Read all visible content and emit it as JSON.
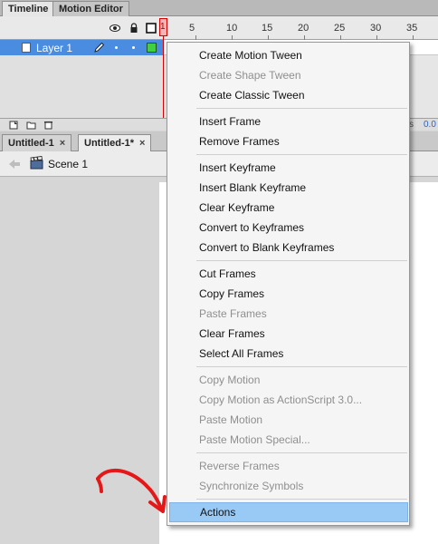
{
  "panel_tabs": {
    "timeline": "Timeline",
    "motion_editor": "Motion Editor"
  },
  "timeline": {
    "ruler_numbers": [
      "5",
      "10",
      "15",
      "20",
      "25",
      "30",
      "35"
    ],
    "playhead_frame": "1",
    "layer": {
      "name": "Layer 1",
      "color": "#3fd13f"
    },
    "footer_status": "s",
    "footer_value": "0.0"
  },
  "doc_tabs": [
    {
      "label": "Untitled-1",
      "close": "×"
    },
    {
      "label": "Untitled-1*",
      "close": "×"
    }
  ],
  "edit_bar": {
    "scene": "Scene 1"
  },
  "context_menu": {
    "items": [
      {
        "label": "Create Motion Tween",
        "enabled": true
      },
      {
        "label": "Create Shape Tween",
        "enabled": false
      },
      {
        "label": "Create Classic Tween",
        "enabled": true
      },
      {
        "label": "Insert Frame",
        "enabled": true
      },
      {
        "label": "Remove Frames",
        "enabled": true
      },
      {
        "label": "Insert Keyframe",
        "enabled": true
      },
      {
        "label": "Insert Blank Keyframe",
        "enabled": true
      },
      {
        "label": "Clear Keyframe",
        "enabled": true
      },
      {
        "label": "Convert to Keyframes",
        "enabled": true
      },
      {
        "label": "Convert to Blank Keyframes",
        "enabled": true
      },
      {
        "label": "Cut Frames",
        "enabled": true
      },
      {
        "label": "Copy Frames",
        "enabled": true
      },
      {
        "label": "Paste Frames",
        "enabled": false
      },
      {
        "label": "Clear Frames",
        "enabled": true
      },
      {
        "label": "Select All Frames",
        "enabled": true
      },
      {
        "label": "Copy Motion",
        "enabled": false
      },
      {
        "label": "Copy Motion as ActionScript 3.0...",
        "enabled": false
      },
      {
        "label": "Paste Motion",
        "enabled": false
      },
      {
        "label": "Paste Motion Special...",
        "enabled": false
      },
      {
        "label": "Reverse Frames",
        "enabled": false
      },
      {
        "label": "Synchronize Symbols",
        "enabled": false
      },
      {
        "label": "Actions",
        "enabled": true,
        "highlighted": true
      }
    ]
  },
  "colors": {
    "selection_blue": "#4a8de0",
    "menu_highlight": "#99c9f5",
    "playhead_red": "#d20000",
    "annotation_red": "#e41818"
  }
}
